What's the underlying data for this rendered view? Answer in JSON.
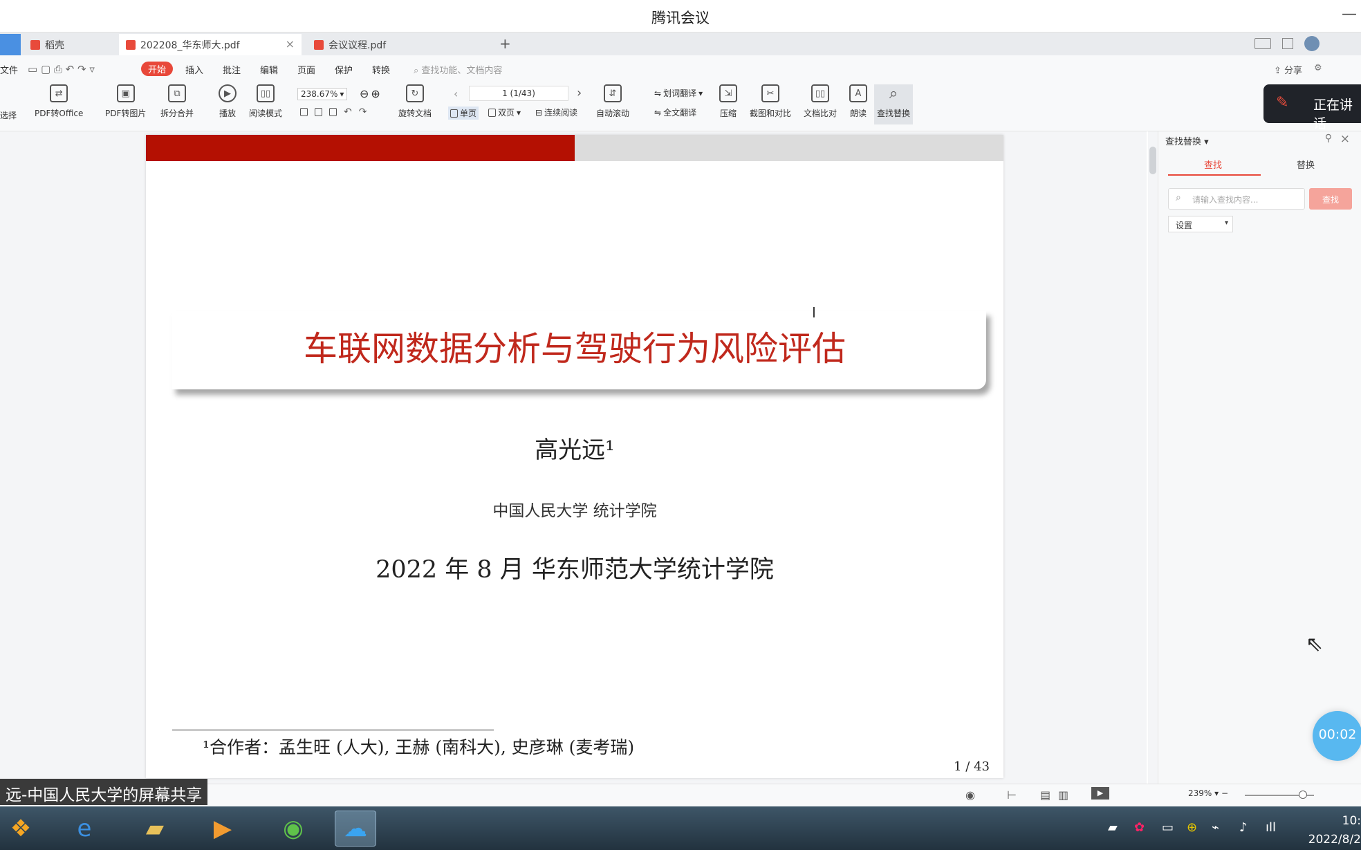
{
  "window": {
    "title": "腾讯会议",
    "minimize": "—"
  },
  "tabs": [
    {
      "label": "稻壳"
    },
    {
      "label": "202208_华东师大.pdf"
    },
    {
      "label": "会议议程.pdf"
    }
  ],
  "new_tab": "+",
  "menu": {
    "file": "文件",
    "start": "开始",
    "insert": "插入",
    "annotate": "批注",
    "edit": "编辑",
    "page": "页面",
    "protect": "保护",
    "convert": "转换",
    "search_placeholder": "查找功能、文档内容",
    "share": "分享"
  },
  "ribbon": {
    "select": "选择",
    "pdf_to_office": "PDF转Office",
    "pdf_to_image": "PDF转图片",
    "split_merge": "拆分合并",
    "play": "播放",
    "read_mode": "阅读模式",
    "zoom_value": "238.67%",
    "rotate_doc": "旋转文档",
    "page_indicator": "1 (1/43)",
    "single_page": "单页",
    "double_page": "双页",
    "continuous": "连续阅读",
    "auto_scroll": "自动滚动",
    "translate_word": "划词翻译",
    "translate_full": "全文翻译",
    "compress": "压缩",
    "screenshot_compare": "截图和对比",
    "doc_compare": "文档比对",
    "read_aloud": "朗读",
    "find_replace": "查找替换"
  },
  "document": {
    "title": "车联网数据分析与驾驶行为风险评估",
    "author": "高光远¹",
    "affiliation": "中国人民大学   统计学院",
    "date_venue": "2022 年 8 月    华东师范大学统计学院",
    "footnote": "¹合作者：孟生旺 (人大), 王赫 (南科大), 史彦琳 (麦考瑞)",
    "page_number": "1 / 43"
  },
  "panel": {
    "header": "查找替换",
    "tab_find": "查找",
    "tab_replace": "替换",
    "search_placeholder": "请输入查找内容...",
    "find_button": "查找",
    "settings": "设置"
  },
  "meeting": {
    "speaking": "正在讲话",
    "timer": "00:02",
    "share_banner": "远-中国人民大学的屏幕共享"
  },
  "statusbar": {
    "zoom": "239%"
  },
  "taskbar": {
    "time": "10:",
    "date": "2022/8/2"
  }
}
